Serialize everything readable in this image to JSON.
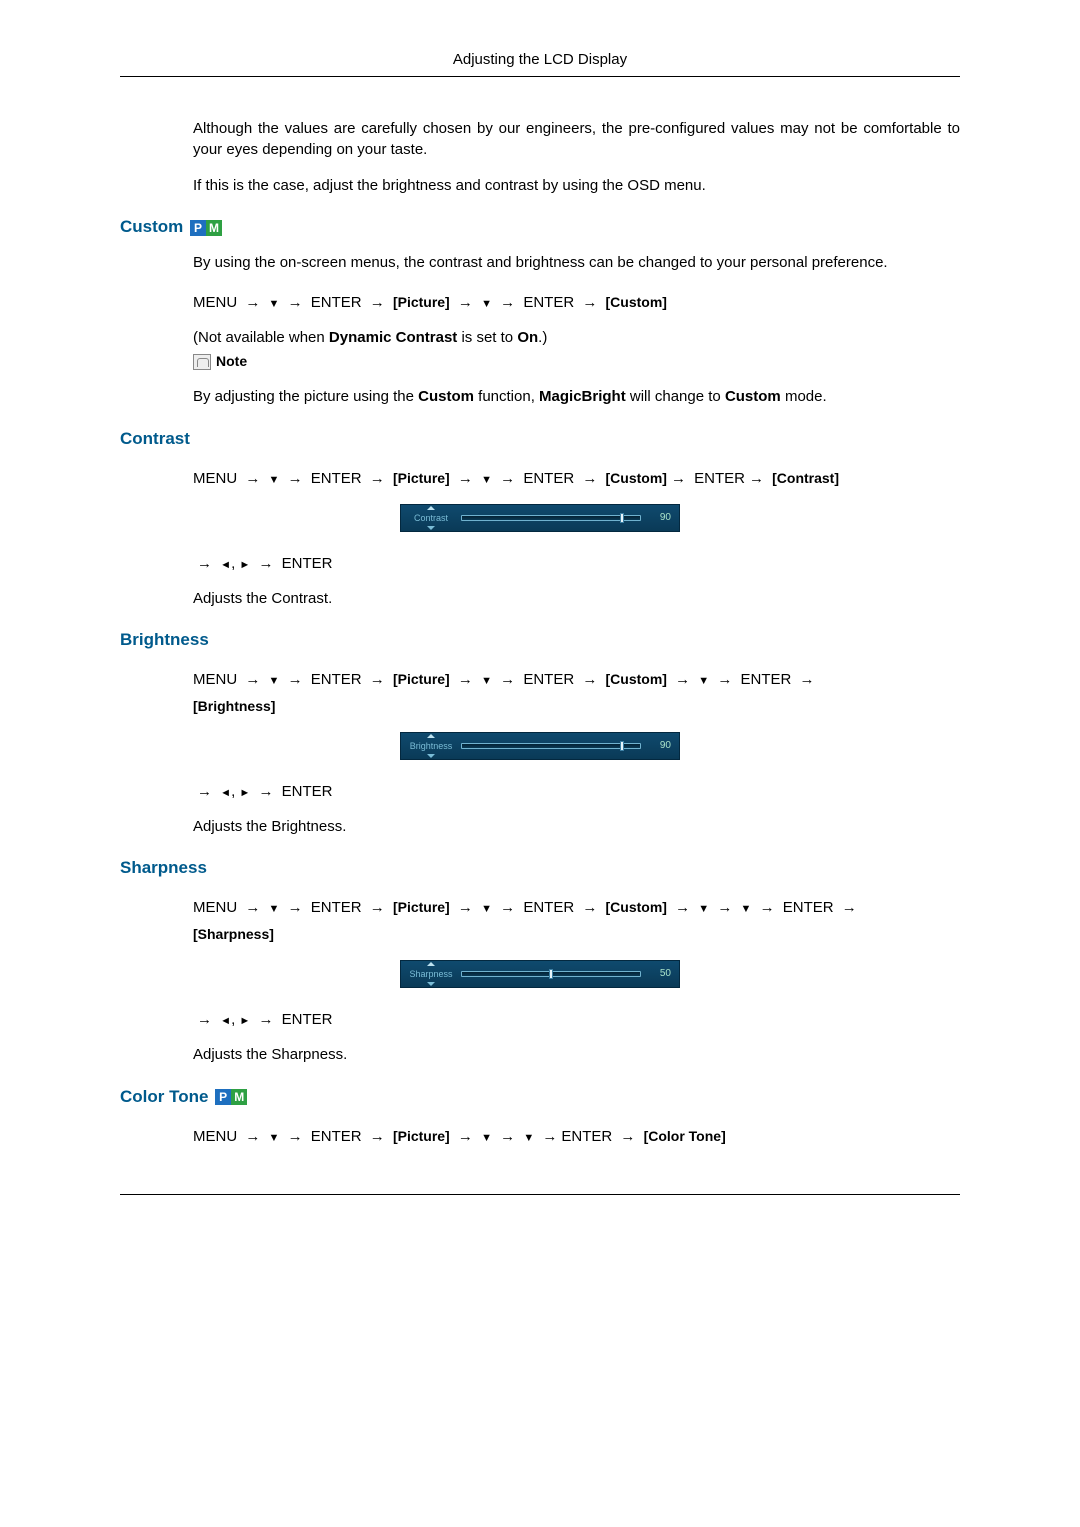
{
  "header": {
    "title": "Adjusting the LCD Display"
  },
  "intro": {
    "p1": "Although the values are carefully chosen by our engineers, the pre-configured values may not be comfortable to your eyes depending on your taste.",
    "p2": "If this is the case, adjust the brightness and contrast by using the OSD menu."
  },
  "custom": {
    "heading": "Custom",
    "p1": "By using the on-screen menus, the contrast and brightness can be changed to your personal preference.",
    "nav": {
      "menu": "MENU",
      "enter": "ENTER",
      "picture": "[Picture]",
      "custom": "[Custom]"
    },
    "not_available_pre": "(Not available when ",
    "dynamic_contrast": "Dynamic Contrast",
    "not_available_mid": " is set to ",
    "on": "On",
    "not_available_end": ".)",
    "note_label": "Note",
    "note_body_pre": "By adjusting the picture using the ",
    "note_custom": "Custom",
    "note_body_mid": " function, ",
    "note_magicbright": "MagicBright",
    "note_body_mid2": " will change to ",
    "note_custom2": "Custom",
    "note_body_end": " mode."
  },
  "contrast": {
    "heading": "Contrast",
    "nav": {
      "menu": "MENU",
      "enter": "ENTER",
      "picture": "[Picture]",
      "custom": "[Custom]",
      "contrast": "[Contrast]"
    },
    "slider": {
      "label": "Contrast",
      "value": 90,
      "max": 100
    },
    "nav2_enter": "ENTER",
    "desc": "Adjusts the Contrast."
  },
  "brightness": {
    "heading": "Brightness",
    "nav": {
      "menu": "MENU",
      "enter": "ENTER",
      "picture": "[Picture]",
      "custom": "[Custom]",
      "brightness": "[Brightness]"
    },
    "slider": {
      "label": "Brightness",
      "value": 90,
      "max": 100
    },
    "nav2_enter": "ENTER",
    "desc": "Adjusts the Brightness."
  },
  "sharpness": {
    "heading": "Sharpness",
    "nav": {
      "menu": "MENU",
      "enter": "ENTER",
      "picture": "[Picture]",
      "custom": "[Custom]",
      "sharpness": "[Sharpness]"
    },
    "slider": {
      "label": "Sharpness",
      "value": 50,
      "max": 100
    },
    "nav2_enter": "ENTER",
    "desc": "Adjusts the Sharpness."
  },
  "colortone": {
    "heading": "Color Tone",
    "nav": {
      "menu": "MENU",
      "enter": "ENTER",
      "picture": "[Picture]",
      "colortone": "[Color Tone]"
    }
  },
  "glyphs": {
    "arrow_right": "→",
    "down_tri": "▼",
    "left_tri": "◄",
    "right_tri": "►",
    "comma": ","
  },
  "pm": {
    "p": "P",
    "m": "M"
  }
}
